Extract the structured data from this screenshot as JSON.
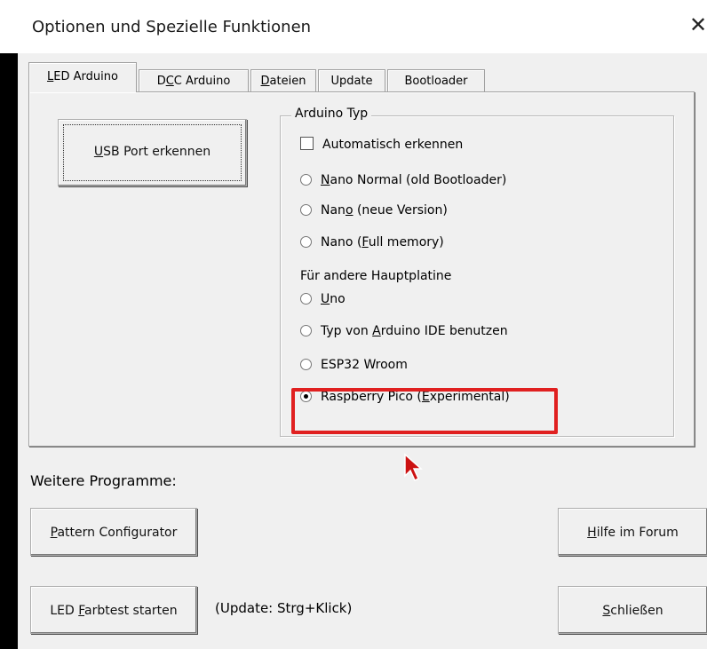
{
  "window": {
    "title": "Optionen und Spezielle Funktionen",
    "close_glyph": "✕"
  },
  "tabs": [
    {
      "pre": "",
      "u": "L",
      "post": "ED Arduino",
      "active": true
    },
    {
      "pre": "D",
      "u": "C",
      "post": "C Arduino",
      "active": false
    },
    {
      "pre": "",
      "u": "D",
      "post": "ateien",
      "active": false
    },
    {
      "pre": "Update",
      "u": "",
      "post": "",
      "active": false
    },
    {
      "pre": "Bootloader",
      "u": "",
      "post": "",
      "active": false
    }
  ],
  "usb_button": {
    "pre": "",
    "u": "U",
    "post": "SB Port erkennen"
  },
  "arduino_group": {
    "legend": "Arduino Typ",
    "auto_detect": {
      "label": "Automatisch erkennen",
      "checked": false
    },
    "options": [
      {
        "pre": "",
        "u": "N",
        "post": "ano Normal (old Bootloader)",
        "selected": false
      },
      {
        "pre": "Nan",
        "u": "o",
        "post": " (neue Version)",
        "selected": false
      },
      {
        "pre": "Nano (",
        "u": "F",
        "post": "ull memory)",
        "selected": false
      }
    ],
    "other_label": "Für andere Hauptplatine",
    "other_options": [
      {
        "pre": "",
        "u": "U",
        "post": "no",
        "selected": false
      },
      {
        "pre": "Typ von ",
        "u": "A",
        "post": "rduino IDE benutzen",
        "selected": false
      },
      {
        "pre": "ESP32 Wroom",
        "u": "",
        "post": "",
        "selected": false
      },
      {
        "pre": "Raspberry Pico (",
        "u": "E",
        "post": "xperimental)",
        "selected": true
      }
    ]
  },
  "programs_label": "Weitere Programme:",
  "buttons": {
    "pattern": {
      "pre": "",
      "u": "P",
      "post": "attern Configurator"
    },
    "forum": {
      "pre": "",
      "u": "H",
      "post": "ilfe im Forum"
    },
    "farbtest": {
      "pre": "LED ",
      "u": "F",
      "post": "arbtest starten"
    },
    "close": {
      "pre": "",
      "u": "S",
      "post": "chließen"
    }
  },
  "update_hint": "(Update: Strg+Klick)",
  "colors": {
    "highlight": "#e02020",
    "cursor": "#cc1111"
  },
  "icons": {
    "close": "close-icon",
    "cursor": "mouse-cursor-icon"
  }
}
